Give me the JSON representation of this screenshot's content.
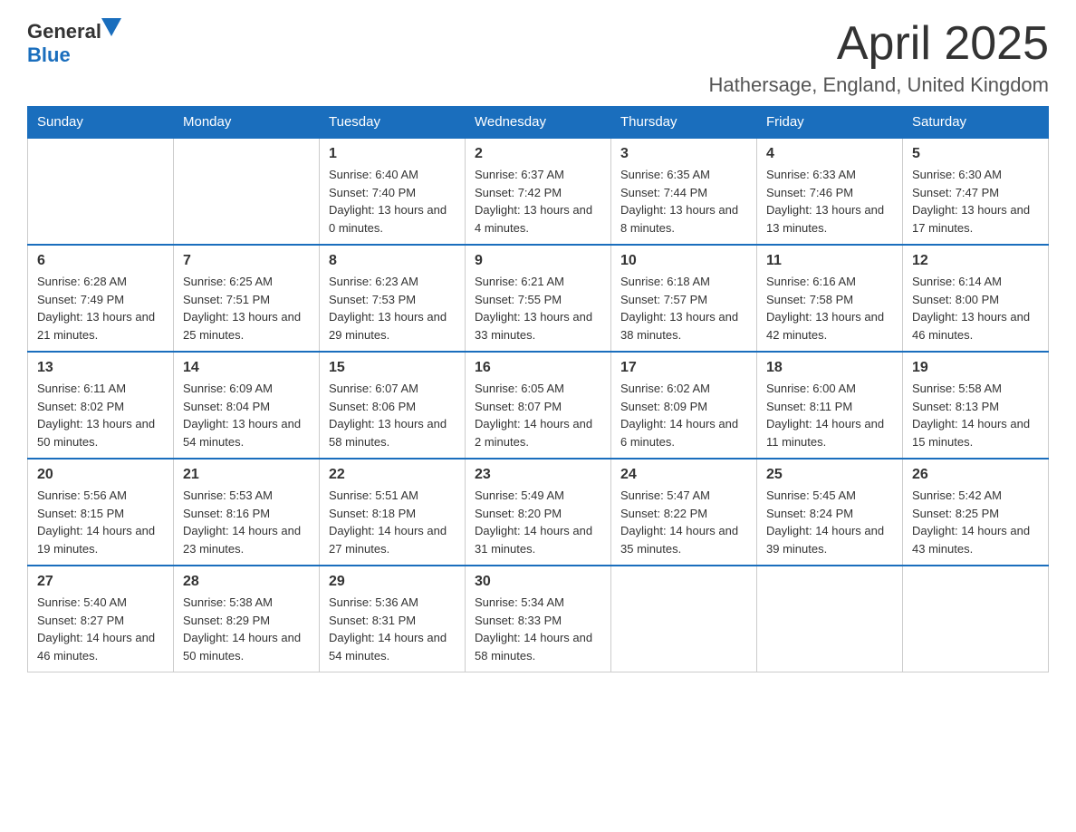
{
  "logo": {
    "general": "General",
    "blue": "Blue"
  },
  "title": "April 2025",
  "location": "Hathersage, England, United Kingdom",
  "headers": [
    "Sunday",
    "Monday",
    "Tuesday",
    "Wednesday",
    "Thursday",
    "Friday",
    "Saturday"
  ],
  "weeks": [
    [
      {
        "day": "",
        "sunrise": "",
        "sunset": "",
        "daylight": ""
      },
      {
        "day": "",
        "sunrise": "",
        "sunset": "",
        "daylight": ""
      },
      {
        "day": "1",
        "sunrise": "Sunrise: 6:40 AM",
        "sunset": "Sunset: 7:40 PM",
        "daylight": "Daylight: 13 hours and 0 minutes."
      },
      {
        "day": "2",
        "sunrise": "Sunrise: 6:37 AM",
        "sunset": "Sunset: 7:42 PM",
        "daylight": "Daylight: 13 hours and 4 minutes."
      },
      {
        "day": "3",
        "sunrise": "Sunrise: 6:35 AM",
        "sunset": "Sunset: 7:44 PM",
        "daylight": "Daylight: 13 hours and 8 minutes."
      },
      {
        "day": "4",
        "sunrise": "Sunrise: 6:33 AM",
        "sunset": "Sunset: 7:46 PM",
        "daylight": "Daylight: 13 hours and 13 minutes."
      },
      {
        "day": "5",
        "sunrise": "Sunrise: 6:30 AM",
        "sunset": "Sunset: 7:47 PM",
        "daylight": "Daylight: 13 hours and 17 minutes."
      }
    ],
    [
      {
        "day": "6",
        "sunrise": "Sunrise: 6:28 AM",
        "sunset": "Sunset: 7:49 PM",
        "daylight": "Daylight: 13 hours and 21 minutes."
      },
      {
        "day": "7",
        "sunrise": "Sunrise: 6:25 AM",
        "sunset": "Sunset: 7:51 PM",
        "daylight": "Daylight: 13 hours and 25 minutes."
      },
      {
        "day": "8",
        "sunrise": "Sunrise: 6:23 AM",
        "sunset": "Sunset: 7:53 PM",
        "daylight": "Daylight: 13 hours and 29 minutes."
      },
      {
        "day": "9",
        "sunrise": "Sunrise: 6:21 AM",
        "sunset": "Sunset: 7:55 PM",
        "daylight": "Daylight: 13 hours and 33 minutes."
      },
      {
        "day": "10",
        "sunrise": "Sunrise: 6:18 AM",
        "sunset": "Sunset: 7:57 PM",
        "daylight": "Daylight: 13 hours and 38 minutes."
      },
      {
        "day": "11",
        "sunrise": "Sunrise: 6:16 AM",
        "sunset": "Sunset: 7:58 PM",
        "daylight": "Daylight: 13 hours and 42 minutes."
      },
      {
        "day": "12",
        "sunrise": "Sunrise: 6:14 AM",
        "sunset": "Sunset: 8:00 PM",
        "daylight": "Daylight: 13 hours and 46 minutes."
      }
    ],
    [
      {
        "day": "13",
        "sunrise": "Sunrise: 6:11 AM",
        "sunset": "Sunset: 8:02 PM",
        "daylight": "Daylight: 13 hours and 50 minutes."
      },
      {
        "day": "14",
        "sunrise": "Sunrise: 6:09 AM",
        "sunset": "Sunset: 8:04 PM",
        "daylight": "Daylight: 13 hours and 54 minutes."
      },
      {
        "day": "15",
        "sunrise": "Sunrise: 6:07 AM",
        "sunset": "Sunset: 8:06 PM",
        "daylight": "Daylight: 13 hours and 58 minutes."
      },
      {
        "day": "16",
        "sunrise": "Sunrise: 6:05 AM",
        "sunset": "Sunset: 8:07 PM",
        "daylight": "Daylight: 14 hours and 2 minutes."
      },
      {
        "day": "17",
        "sunrise": "Sunrise: 6:02 AM",
        "sunset": "Sunset: 8:09 PM",
        "daylight": "Daylight: 14 hours and 6 minutes."
      },
      {
        "day": "18",
        "sunrise": "Sunrise: 6:00 AM",
        "sunset": "Sunset: 8:11 PM",
        "daylight": "Daylight: 14 hours and 11 minutes."
      },
      {
        "day": "19",
        "sunrise": "Sunrise: 5:58 AM",
        "sunset": "Sunset: 8:13 PM",
        "daylight": "Daylight: 14 hours and 15 minutes."
      }
    ],
    [
      {
        "day": "20",
        "sunrise": "Sunrise: 5:56 AM",
        "sunset": "Sunset: 8:15 PM",
        "daylight": "Daylight: 14 hours and 19 minutes."
      },
      {
        "day": "21",
        "sunrise": "Sunrise: 5:53 AM",
        "sunset": "Sunset: 8:16 PM",
        "daylight": "Daylight: 14 hours and 23 minutes."
      },
      {
        "day": "22",
        "sunrise": "Sunrise: 5:51 AM",
        "sunset": "Sunset: 8:18 PM",
        "daylight": "Daylight: 14 hours and 27 minutes."
      },
      {
        "day": "23",
        "sunrise": "Sunrise: 5:49 AM",
        "sunset": "Sunset: 8:20 PM",
        "daylight": "Daylight: 14 hours and 31 minutes."
      },
      {
        "day": "24",
        "sunrise": "Sunrise: 5:47 AM",
        "sunset": "Sunset: 8:22 PM",
        "daylight": "Daylight: 14 hours and 35 minutes."
      },
      {
        "day": "25",
        "sunrise": "Sunrise: 5:45 AM",
        "sunset": "Sunset: 8:24 PM",
        "daylight": "Daylight: 14 hours and 39 minutes."
      },
      {
        "day": "26",
        "sunrise": "Sunrise: 5:42 AM",
        "sunset": "Sunset: 8:25 PM",
        "daylight": "Daylight: 14 hours and 43 minutes."
      }
    ],
    [
      {
        "day": "27",
        "sunrise": "Sunrise: 5:40 AM",
        "sunset": "Sunset: 8:27 PM",
        "daylight": "Daylight: 14 hours and 46 minutes."
      },
      {
        "day": "28",
        "sunrise": "Sunrise: 5:38 AM",
        "sunset": "Sunset: 8:29 PM",
        "daylight": "Daylight: 14 hours and 50 minutes."
      },
      {
        "day": "29",
        "sunrise": "Sunrise: 5:36 AM",
        "sunset": "Sunset: 8:31 PM",
        "daylight": "Daylight: 14 hours and 54 minutes."
      },
      {
        "day": "30",
        "sunrise": "Sunrise: 5:34 AM",
        "sunset": "Sunset: 8:33 PM",
        "daylight": "Daylight: 14 hours and 58 minutes."
      },
      {
        "day": "",
        "sunrise": "",
        "sunset": "",
        "daylight": ""
      },
      {
        "day": "",
        "sunrise": "",
        "sunset": "",
        "daylight": ""
      },
      {
        "day": "",
        "sunrise": "",
        "sunset": "",
        "daylight": ""
      }
    ]
  ]
}
